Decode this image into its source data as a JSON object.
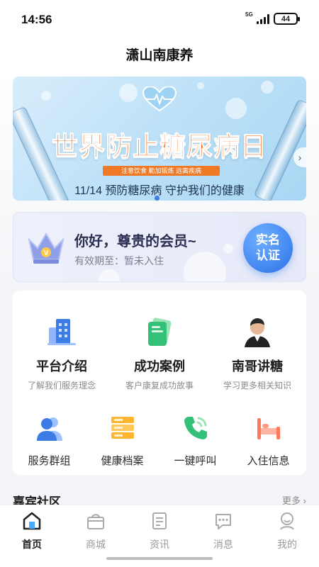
{
  "status_bar": {
    "time": "14:56",
    "network": "5G",
    "battery": "44"
  },
  "header": {
    "title": "潇山南康养"
  },
  "banner": {
    "title": "世界防止糖尿病日",
    "tagline": "注意饮食 勤加锻炼 远离疾病",
    "subtitle": "11/14  预防糖尿病  守护我们的健康"
  },
  "member_card": {
    "greeting": "你好，尊贵的会员~",
    "validity": "有效期至：暂未入住",
    "verify_button": "实名\n认证",
    "verify_line1": "实名",
    "verify_line2": "认证"
  },
  "features": [
    {
      "label": "平台介绍",
      "desc": "了解我们服务理念",
      "icon": "building-icon"
    },
    {
      "label": "成功案例",
      "desc": "客户康复成功故事",
      "icon": "folder-icon"
    },
    {
      "label": "南哥讲糖",
      "desc": "学习更多相关知识",
      "icon": "avatar-icon"
    }
  ],
  "services": [
    {
      "label": "服务群组",
      "icon": "group-icon"
    },
    {
      "label": "健康档案",
      "icon": "archive-icon"
    },
    {
      "label": "一键呼叫",
      "icon": "phone-icon"
    },
    {
      "label": "入住信息",
      "icon": "bed-icon"
    }
  ],
  "community": {
    "title": "嘉宾社区",
    "more": "更多 ›"
  },
  "tabbar": [
    {
      "label": "首页",
      "icon": "home-icon",
      "active": true
    },
    {
      "label": "商城",
      "icon": "shop-icon",
      "active": false
    },
    {
      "label": "资讯",
      "icon": "news-icon",
      "active": false
    },
    {
      "label": "消息",
      "icon": "message-icon",
      "active": false
    },
    {
      "label": "我的",
      "icon": "profile-icon",
      "active": false
    }
  ],
  "colors": {
    "accent": "#2c71e8",
    "banner_title": "#f26a15"
  }
}
